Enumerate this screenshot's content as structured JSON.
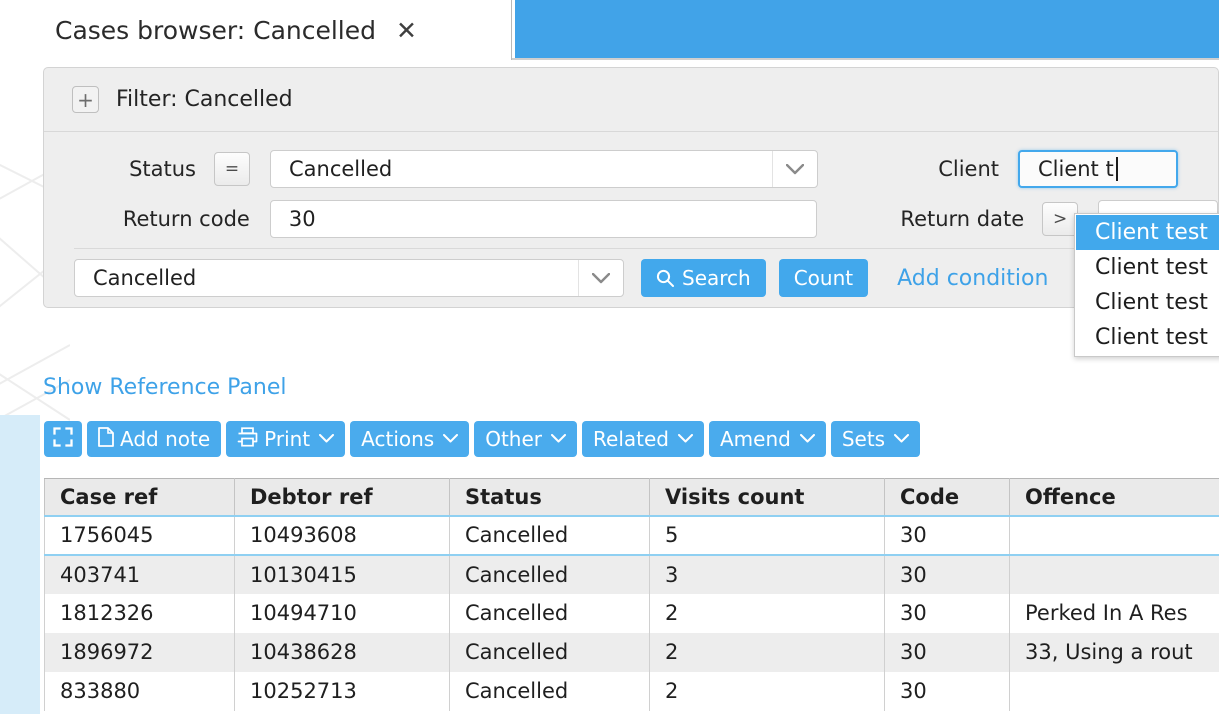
{
  "tab": {
    "title": "Cases browser: Cancelled",
    "close_icon": "close-icon",
    "close_glyph": "✕"
  },
  "filter": {
    "expand_glyph": "+",
    "header_label": "Filter: Cancelled",
    "rows": [
      {
        "label": "Status",
        "operator": "=",
        "value": "Cancelled",
        "control": "select"
      },
      {
        "label": "Return code",
        "operator": "",
        "value": "30",
        "control": "text"
      },
      {
        "label": "Client",
        "operator": "",
        "value": "Client t",
        "control": "text-focused"
      },
      {
        "label": "Return date",
        "operator": ">",
        "value": "",
        "control": "text"
      }
    ],
    "status_select_value": "Cancelled",
    "search_label": "Search",
    "search_icon": "magnifier-icon",
    "count_label": "Count",
    "add_condition_label": "Add condition",
    "caret_glyph": "⌄"
  },
  "autocomplete": {
    "items": [
      {
        "label": "Client test",
        "selected": true
      },
      {
        "label": "Client test",
        "selected": false
      },
      {
        "label": "Client test",
        "selected": false
      },
      {
        "label": "Client test",
        "selected": false
      }
    ]
  },
  "reference_panel": {
    "link_label": "Show Reference Panel"
  },
  "toolbar": {
    "buttons": [
      {
        "label": "",
        "icon": "expand-icon",
        "caret": false
      },
      {
        "label": "Add note",
        "icon": "document-icon",
        "caret": false
      },
      {
        "label": "Print",
        "icon": "printer-icon",
        "caret": true
      },
      {
        "label": "Actions",
        "icon": "",
        "caret": true
      },
      {
        "label": "Other",
        "icon": "",
        "caret": true
      },
      {
        "label": "Related",
        "icon": "",
        "caret": true
      },
      {
        "label": "Amend",
        "icon": "",
        "caret": true
      },
      {
        "label": "Sets",
        "icon": "",
        "caret": true
      }
    ],
    "caret_glyph": "⌄"
  },
  "grid": {
    "columns": [
      "Case ref",
      "Debtor ref",
      "Status",
      "Visits count",
      "Code",
      "Offence"
    ],
    "rows": [
      {
        "cells": [
          "1756045",
          "10493608",
          "Cancelled",
          "5",
          "30",
          ""
        ],
        "focused": true
      },
      {
        "cells": [
          "403741",
          "10130415",
          "Cancelled",
          "3",
          "30",
          ""
        ],
        "focused": false
      },
      {
        "cells": [
          "1812326",
          "10494710",
          "Cancelled",
          "2",
          "30",
          "Perked In A Res"
        ],
        "focused": false
      },
      {
        "cells": [
          "1896972",
          "10438628",
          "Cancelled",
          "2",
          "30",
          "33, Using a rout"
        ],
        "focused": false
      },
      {
        "cells": [
          "833880",
          "10252713",
          "Cancelled",
          "2",
          "30",
          ""
        ],
        "focused": false
      }
    ]
  },
  "colors": {
    "accent": "#41a3e8",
    "toolbar_button": "#4aabed",
    "link": "#3ea2e8",
    "panel_bg": "#eeeeee",
    "row_stripe": "#ededed",
    "focus_border": "#8fd0f2",
    "left_band": "#d6ecf9"
  }
}
